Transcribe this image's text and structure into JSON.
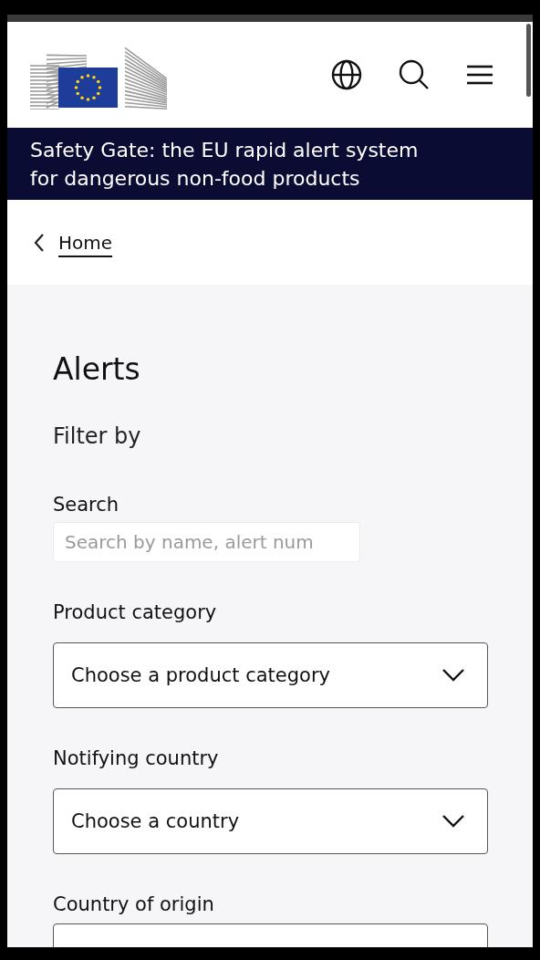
{
  "site_title": "Safety Gate: the EU rapid alert system for dangerous non-food products",
  "breadcrumb": {
    "label": "Home"
  },
  "page_title": "Alerts",
  "filter_heading": "Filter by",
  "fields": [
    {
      "kind": "search",
      "label": "Search",
      "placeholder": "Search by name, alert num"
    },
    {
      "kind": "select",
      "label": "Product category",
      "value": "Choose a product category"
    },
    {
      "kind": "select",
      "label": "Notifying country",
      "value": "Choose a country"
    },
    {
      "kind": "select",
      "label": "Country of origin"
    }
  ]
}
